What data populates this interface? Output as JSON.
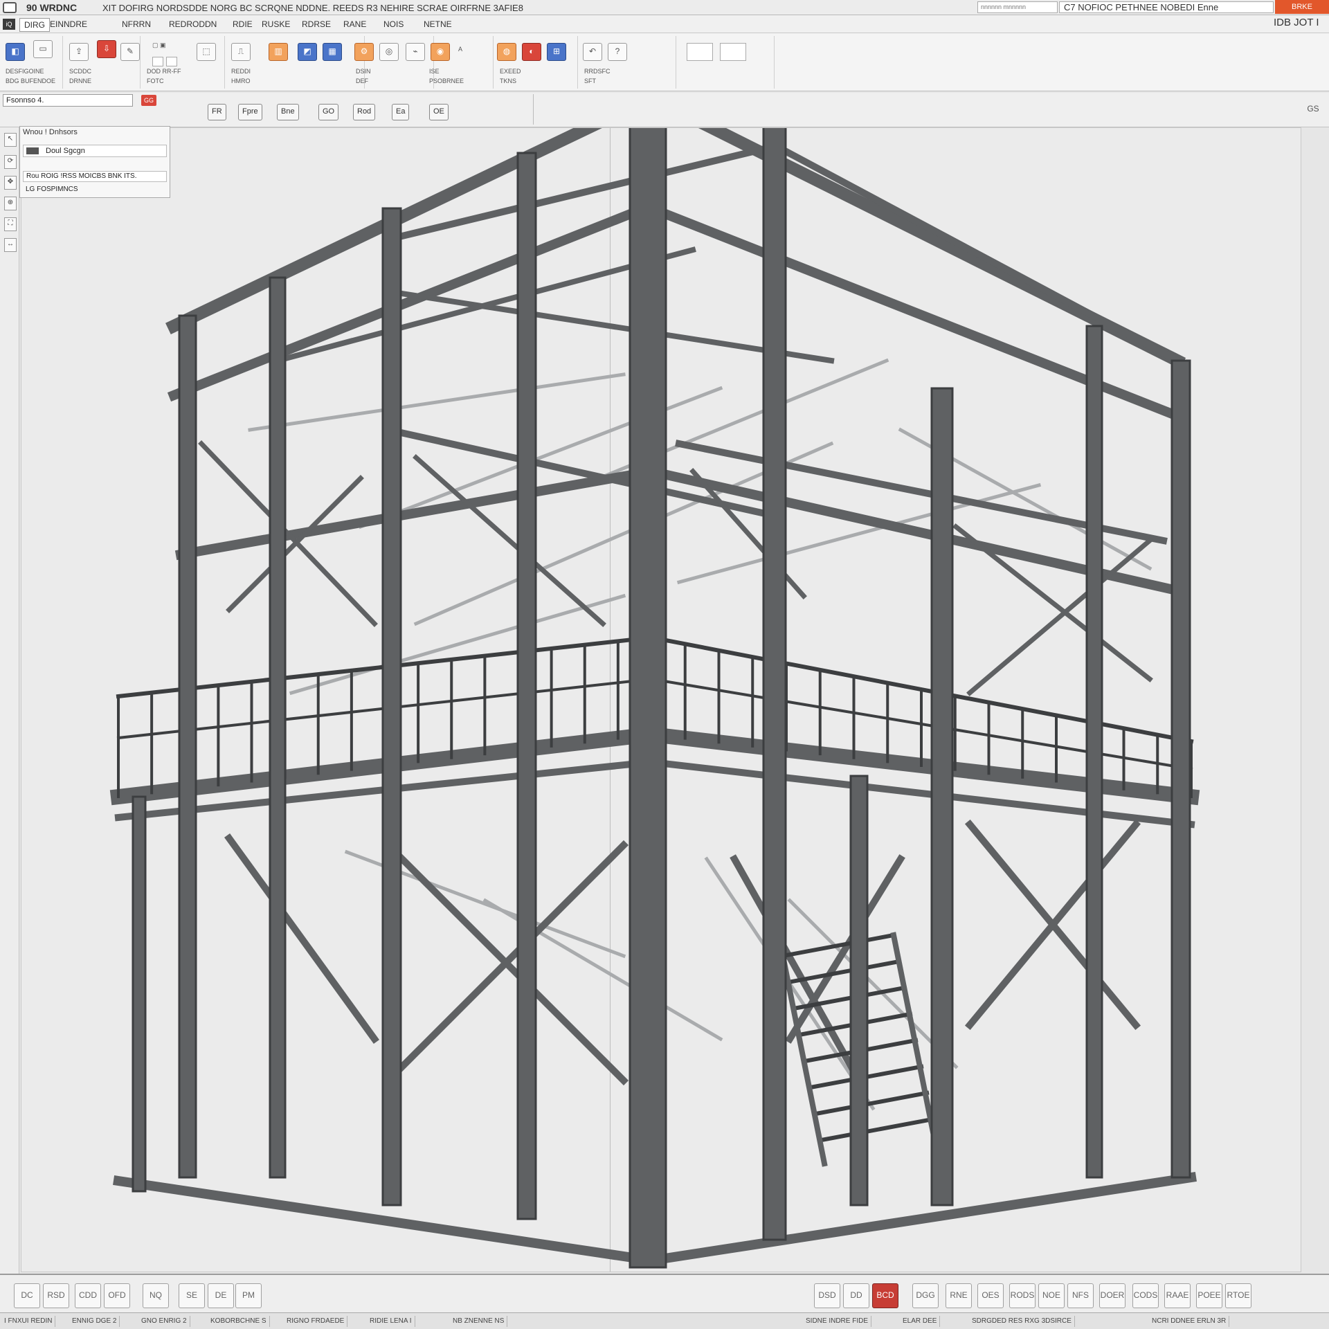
{
  "titlebar": {
    "app_title": "90 WRDNC",
    "doc_title": "XIT DOFIRG  NORDSDDE NORG  BC SCRQNE  NDDNE.  REEDS  R3 NEHIRE SCRAE OIRFRNE 3AFIE8",
    "search_placeholder": "nnnnnn mnnnnn",
    "help_text": "C7 NOFIOC PETHNEE   NOBEDI Enne",
    "close_label": "BRKE"
  },
  "menubar": {
    "quick_label": "iQ",
    "tabs": [
      "DIRG",
      "EINNDRE",
      "NFRRN",
      "REDRODDN",
      "RDIE",
      "RUSKE",
      "RDRSE",
      "RANE",
      "NOIS",
      "NETNE"
    ],
    "right_label": "IDB JOT I"
  },
  "ribbon": {
    "groups": [
      {
        "label": "DESFIGOINE",
        "sublabel": "BDG  BUFENDOE"
      },
      {
        "label": "SCDDC",
        "sublabel": "DRNNE"
      },
      {
        "label": "DOD  RR-FF",
        "sublabel": "FOTC"
      },
      {
        "label": "REDDI",
        "sublabel": "HMRO"
      },
      {
        "label": "DSIN",
        "sublabel": "DEF"
      },
      {
        "label": "ISE",
        "sublabel": "PSOBRNEE"
      },
      {
        "label": "EXEED",
        "sublabel": "TKNS"
      },
      {
        "label": "RRDSFC",
        "sublabel": "SFT"
      }
    ],
    "icons": [
      "file-icon",
      "save-icon",
      "export-icon",
      "import-icon",
      "pen-icon",
      "select-icon",
      "beam-icon",
      "column-icon",
      "brace-icon",
      "plate-icon",
      "bolt-icon",
      "weld-icon",
      "analysis-icon",
      "mesh-icon",
      "report-icon",
      "render-icon",
      "undo-icon",
      "help-icon"
    ]
  },
  "cmdbar": {
    "combo_value": "Fsonnso 4.",
    "flag_label": "GG",
    "tools": [
      "FR",
      "Fpre",
      "Bne",
      "GO",
      "Rod",
      "Ea",
      "OE"
    ],
    "tool_icons": [
      "section-icon",
      "frame-icon",
      "beam-icon",
      "grid-icon",
      "rod-icon",
      "edit-icon",
      "options-icon"
    ]
  },
  "panel": {
    "title": "Wnou ! Dnhsors",
    "row1": "Doul Sgcgn",
    "row2": "Rou ROIG !RSS  MOICBS  BNK  ITS.",
    "row3": "LG  FOSPIMNCS"
  },
  "leftstrip": {
    "tools": [
      "pointer-icon",
      "rotate-icon",
      "pan-icon",
      "zoom-icon",
      "fit-icon",
      "measure-icon",
      "section-icon",
      "grid-icon",
      "snap-icon"
    ]
  },
  "viewport": {
    "corner_label": "GS",
    "model_name": "steel-frame-tower",
    "colors": {
      "steel": "#5f6163",
      "steel_dark": "#3c3e40",
      "background": "#ebebeb",
      "mesh": "#a9abad"
    }
  },
  "bottombar": {
    "left_tools": [
      "DC",
      "RSD",
      "CDD",
      "OFD",
      "NQ",
      "SE",
      "DE",
      "PM"
    ],
    "right_tools": [
      "DSD",
      "DD",
      "DGG",
      "RNE",
      "OES",
      "RODS",
      "NOE",
      "NFS",
      "DOER",
      "CODS",
      "RAAE",
      "POEE",
      "RTOE"
    ],
    "red_tool": "BCD"
  },
  "statusbar": {
    "cells": [
      "I FNXUI REDIN",
      "ENNIG  DGE 2",
      "GNO  ENRIG 2",
      "KOBORBCHNE  S",
      "RIGNO  FRDAEDE",
      "RIDIE  LENA  I",
      "NB  ZNENNE  NS",
      "SIDNE  INDRE  FIDE",
      "ELAR  DEE",
      "SDRGDED  RES  RXG  3DSIRCE",
      "NCRI  DDNEE  ERLN  3R"
    ]
  }
}
